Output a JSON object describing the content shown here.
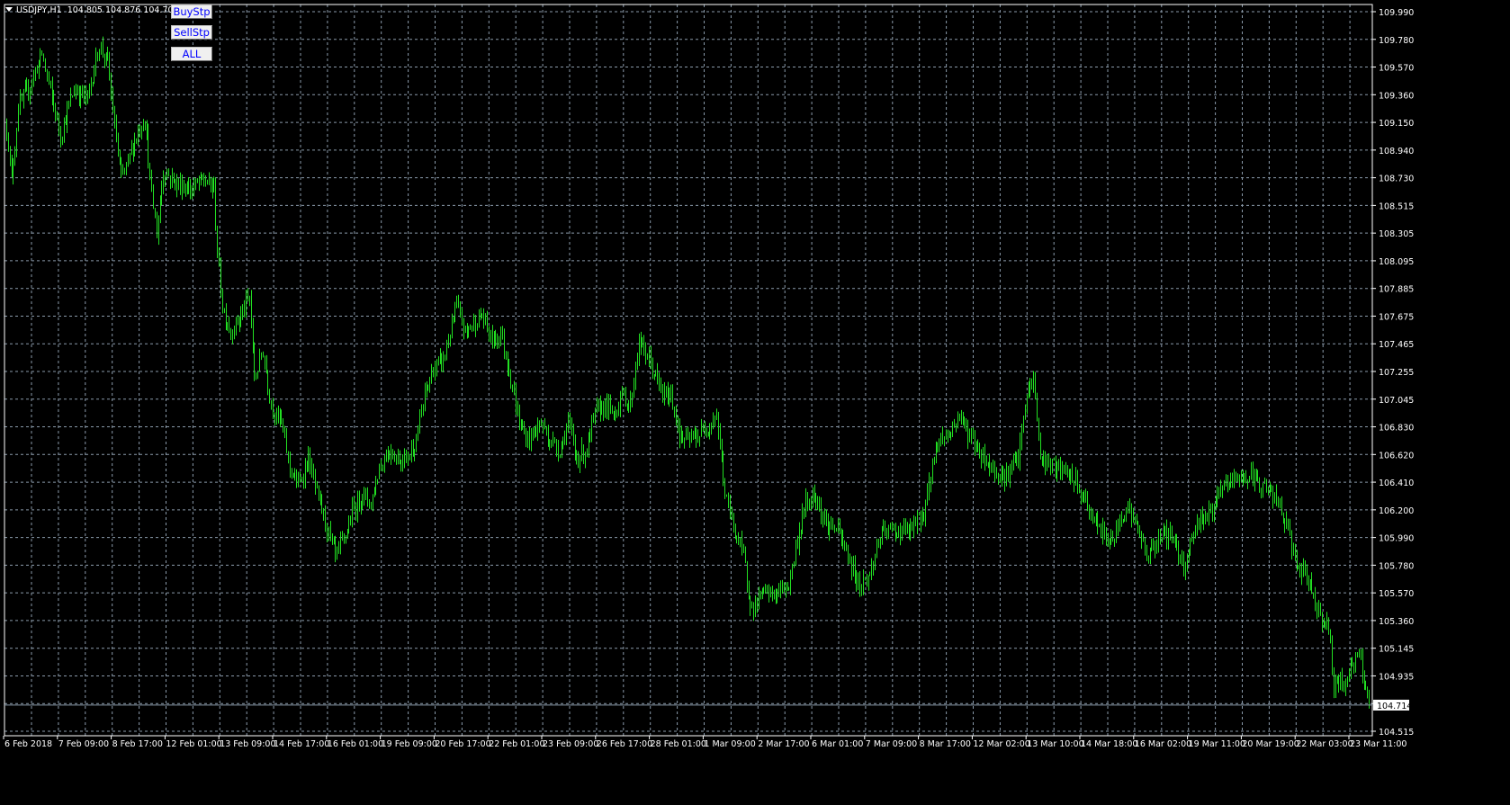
{
  "header": {
    "symbol": "USDJPY,H1",
    "ohlc": "104.805 104.876 104.703 104.7"
  },
  "buttons": {
    "buy_stop": "BuyStp",
    "sell_stop": "SellStp",
    "all": "ALL"
  },
  "colors": {
    "background": "#000000",
    "bars": "#22e022",
    "grid": "#8a9aaa",
    "axis": "#ffffff",
    "price_line": "#8a9aaa",
    "button_text": "#0000ff"
  },
  "chart_data": {
    "type": "ohlc-bar",
    "title": "USDJPY,H1",
    "timeframe": "H1",
    "ylim": [
      104.515,
      109.99
    ],
    "grid": true,
    "current_price": "104.714",
    "y_ticks": [
      "109.990",
      "109.780",
      "109.570",
      "109.360",
      "109.150",
      "108.940",
      "108.730",
      "108.515",
      "108.305",
      "108.095",
      "107.885",
      "107.675",
      "107.465",
      "107.255",
      "107.045",
      "106.830",
      "106.620",
      "106.410",
      "106.200",
      "105.990",
      "105.780",
      "105.570",
      "105.360",
      "105.145",
      "104.935",
      "104.725",
      "104.515"
    ],
    "x_ticks": [
      "6 Feb 2018",
      "7 Feb 09:00",
      "8 Feb 17:00",
      "12 Feb 01:00",
      "13 Feb 09:00",
      "14 Feb 17:00",
      "16 Feb 01:00",
      "19 Feb 09:00",
      "20 Feb 17:00",
      "22 Feb 01:00",
      "23 Feb 09:00",
      "26 Feb 17:00",
      "28 Feb 01:00",
      "1 Mar 09:00",
      "2 Mar 17:00",
      "6 Mar 01:00",
      "7 Mar 09:00",
      "8 Mar 17:00",
      "12 Mar 02:00",
      "13 Mar 10:00",
      "14 Mar 18:00",
      "16 Mar 02:00",
      "19 Mar 11:00",
      "20 Mar 19:00",
      "22 Mar 03:00",
      "23 Mar 11:00"
    ],
    "bars_total": 809,
    "price_path": [
      [
        0,
        109.12
      ],
      [
        3,
        108.71
      ],
      [
        7,
        109.26
      ],
      [
        13,
        109.4
      ],
      [
        21,
        109.67
      ],
      [
        27,
        109.33
      ],
      [
        32,
        109.05
      ],
      [
        40,
        109.4
      ],
      [
        48,
        109.33
      ],
      [
        55,
        109.74
      ],
      [
        60,
        109.6
      ],
      [
        64,
        109.12
      ],
      [
        68,
        108.71
      ],
      [
        72,
        108.85
      ],
      [
        77,
        109.05
      ],
      [
        82,
        109.19
      ],
      [
        85,
        108.71
      ],
      [
        89,
        108.3
      ],
      [
        93,
        108.78
      ],
      [
        101,
        108.68
      ],
      [
        109,
        108.64
      ],
      [
        117,
        108.71
      ],
      [
        123,
        108.64
      ],
      [
        125,
        108.16
      ],
      [
        128,
        107.75
      ],
      [
        133,
        107.55
      ],
      [
        139,
        107.68
      ],
      [
        144,
        107.82
      ],
      [
        147,
        107.2
      ],
      [
        152,
        107.41
      ],
      [
        157,
        107.0
      ],
      [
        163,
        106.86
      ],
      [
        168,
        106.52
      ],
      [
        173,
        106.38
      ],
      [
        179,
        106.59
      ],
      [
        184,
        106.32
      ],
      [
        189,
        106.11
      ],
      [
        195,
        105.84
      ],
      [
        200,
        105.97
      ],
      [
        205,
        106.18
      ],
      [
        211,
        106.32
      ],
      [
        216,
        106.25
      ],
      [
        221,
        106.52
      ],
      [
        227,
        106.66
      ],
      [
        232,
        106.59
      ],
      [
        237,
        106.59
      ],
      [
        243,
        106.73
      ],
      [
        248,
        107.07
      ],
      [
        253,
        107.27
      ],
      [
        259,
        107.34
      ],
      [
        267,
        107.75
      ],
      [
        272,
        107.55
      ],
      [
        277,
        107.62
      ],
      [
        282,
        107.68
      ],
      [
        288,
        107.48
      ],
      [
        293,
        107.55
      ],
      [
        298,
        107.27
      ],
      [
        304,
        106.86
      ],
      [
        309,
        106.73
      ],
      [
        317,
        106.86
      ],
      [
        322,
        106.73
      ],
      [
        328,
        106.66
      ],
      [
        333,
        106.86
      ],
      [
        338,
        106.59
      ],
      [
        344,
        106.66
      ],
      [
        349,
        106.93
      ],
      [
        354,
        107.0
      ],
      [
        360,
        106.93
      ],
      [
        365,
        107.07
      ],
      [
        370,
        107.0
      ],
      [
        375,
        107.48
      ],
      [
        381,
        107.34
      ],
      [
        389,
        107.07
      ],
      [
        394,
        107.07
      ],
      [
        400,
        106.73
      ],
      [
        405,
        106.73
      ],
      [
        413,
        106.79
      ],
      [
        421,
        106.93
      ],
      [
        426,
        106.32
      ],
      [
        432,
        106.04
      ],
      [
        437,
        105.84
      ],
      [
        442,
        105.43
      ],
      [
        448,
        105.56
      ],
      [
        456,
        105.56
      ],
      [
        464,
        105.63
      ],
      [
        469,
        105.97
      ],
      [
        474,
        106.25
      ],
      [
        480,
        106.32
      ],
      [
        485,
        106.11
      ],
      [
        493,
        106.04
      ],
      [
        501,
        105.77
      ],
      [
        506,
        105.63
      ],
      [
        512,
        105.7
      ],
      [
        517,
        105.97
      ],
      [
        522,
        106.04
      ],
      [
        530,
        106.04
      ],
      [
        536,
        106.04
      ],
      [
        544,
        106.18
      ],
      [
        552,
        106.73
      ],
      [
        560,
        106.79
      ],
      [
        565,
        106.93
      ],
      [
        570,
        106.79
      ],
      [
        576,
        106.66
      ],
      [
        584,
        106.52
      ],
      [
        592,
        106.45
      ],
      [
        600,
        106.59
      ],
      [
        605,
        107.07
      ],
      [
        609,
        107.2
      ],
      [
        613,
        106.59
      ],
      [
        621,
        106.52
      ],
      [
        632,
        106.45
      ],
      [
        640,
        106.25
      ],
      [
        648,
        106.04
      ],
      [
        656,
        105.97
      ],
      [
        664,
        106.25
      ],
      [
        669,
        106.11
      ],
      [
        677,
        105.84
      ],
      [
        685,
        106.04
      ],
      [
        693,
        105.97
      ],
      [
        698,
        105.77
      ],
      [
        706,
        106.11
      ],
      [
        714,
        106.18
      ],
      [
        722,
        106.38
      ],
      [
        730,
        106.45
      ],
      [
        738,
        106.45
      ],
      [
        746,
        106.38
      ],
      [
        754,
        106.25
      ],
      [
        760,
        106.04
      ],
      [
        765,
        105.77
      ],
      [
        773,
        105.63
      ],
      [
        778,
        105.43
      ],
      [
        784,
        105.29
      ],
      [
        787,
        104.88
      ],
      [
        793,
        104.88
      ],
      [
        797,
        105.01
      ],
      [
        802,
        105.08
      ],
      [
        808,
        104.74
      ]
    ]
  }
}
